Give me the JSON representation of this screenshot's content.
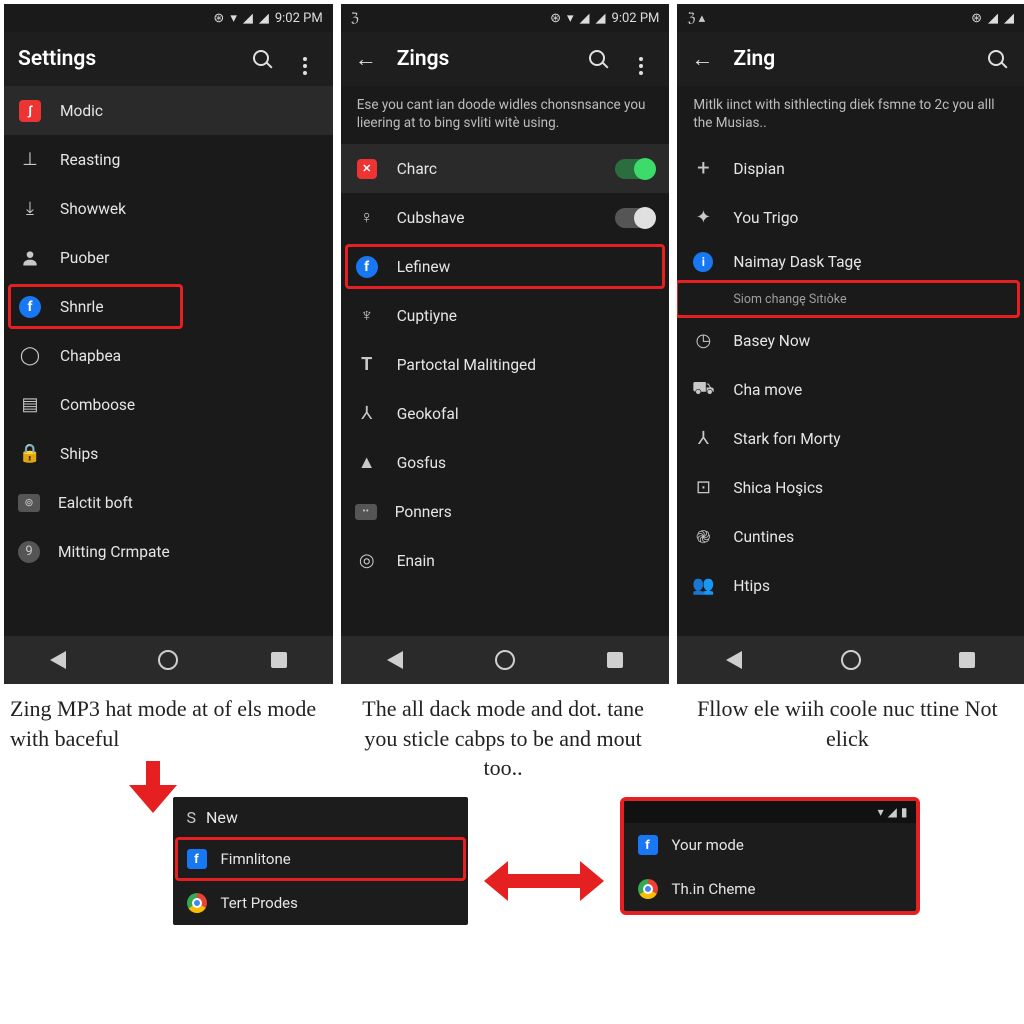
{
  "status_time": "9:02 PM",
  "panel1": {
    "title": "Settings",
    "items": [
      {
        "icon": "red-badge",
        "label": "Modic"
      },
      {
        "icon": "reasting",
        "label": "Reasting"
      },
      {
        "icon": "bookmark",
        "label": "Showwek"
      },
      {
        "icon": "person",
        "label": "Puober"
      },
      {
        "icon": "fb",
        "label": "Shnrle",
        "hl": true
      },
      {
        "icon": "circle",
        "label": "Chapbea"
      },
      {
        "icon": "calendar",
        "label": "Comboose"
      },
      {
        "icon": "lock",
        "label": "Ships"
      },
      {
        "icon": "target",
        "label": "Ealctit boft"
      },
      {
        "icon": "nine",
        "label": "Mitting Crmpate"
      }
    ]
  },
  "panel2": {
    "title": "Zings",
    "desc": "Ese you cant ian doode widles chonsnsance you lieering at to bing svliti witè using.",
    "items": [
      {
        "icon": "red-badge-sm",
        "label": "Charc",
        "toggle": "on"
      },
      {
        "icon": "cubshave",
        "label": "Cubshave",
        "toggle": "off"
      },
      {
        "icon": "fb",
        "label": "Lefinew",
        "hl": true
      },
      {
        "icon": "headset",
        "label": "Cuptiyne"
      },
      {
        "icon": "T",
        "label": "Partoctal Malitinged"
      },
      {
        "icon": "stick",
        "label": "Geokofal"
      },
      {
        "icon": "mountain",
        "label": "Gosfus"
      },
      {
        "icon": "ponners",
        "label": "Ponners"
      },
      {
        "icon": "gear",
        "label": "Enain"
      }
    ]
  },
  "panel3": {
    "title": "Zing",
    "desc": "Mitlk iinct with sithlecting diek fsmne to 2c you alll the Musias..",
    "items": [
      {
        "icon": "plus",
        "label": "Dispian"
      },
      {
        "icon": "star",
        "label": "You Trigo"
      },
      {
        "icon": "info",
        "label": "Naimay Dask Tagę"
      },
      {
        "icon": "",
        "label": "Siom changę Sıtıòke",
        "sub": true,
        "hl": true
      },
      {
        "icon": "clock",
        "label": "Basey Now"
      },
      {
        "icon": "car",
        "label": "Cha move"
      },
      {
        "icon": "stick",
        "label": "Stark forı Morty"
      },
      {
        "icon": "square-dot",
        "label": "Shica Hoşics"
      },
      {
        "icon": "spiral",
        "label": "Cuntines"
      },
      {
        "icon": "people",
        "label": "Htips"
      }
    ]
  },
  "caption1": "Zing MP3 hat mode at of els mode with baceful",
  "caption2": "The all dack mode and dot. tane you sticle cabps to be and mout too..",
  "caption3": "Fllow ele wiih coole nuc ttine Not elick",
  "mini1": {
    "header": "New",
    "header_icon_label": "S",
    "items": [
      {
        "icon": "fb-sq",
        "label": "Fimnlitone",
        "hl": true
      },
      {
        "icon": "chrome",
        "label": "Tert Prodes"
      }
    ]
  },
  "mini2": {
    "items": [
      {
        "icon": "fb-sq",
        "label": "Your mode"
      },
      {
        "icon": "chrome",
        "label": "Th.in Cheme"
      }
    ]
  }
}
